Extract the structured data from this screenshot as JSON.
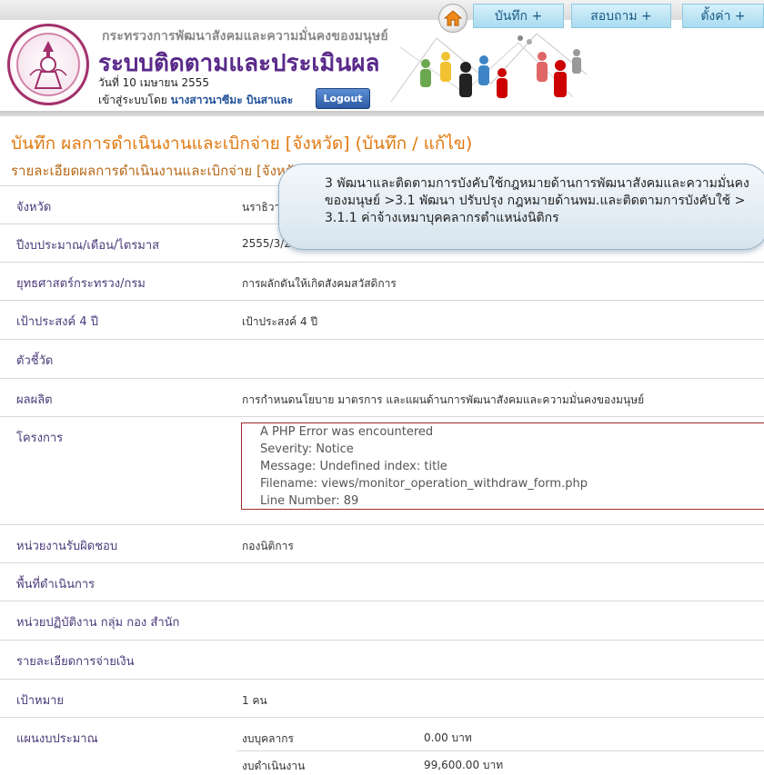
{
  "header": {
    "ministry": "กระทรวงการพัฒนาสังคมและความมั่นคงของมนุษย์",
    "system_title": "ระบบติดตามและประเมินผล",
    "date": "วันที่ 10 เมษายน 2555",
    "login_prefix": "เข้าสู่ระบบโดย",
    "username": "นางสาวนาซีมะ บินสาและ",
    "logout_label": "Logout",
    "nav": [
      "บันทึก +",
      "สอบถาม +",
      "ตั้งค่า +"
    ],
    "accent_color": "#5a2a8a"
  },
  "page": {
    "title": "บันทึก ผลการดำเนินงานและเบิกจ่าย [จังหวัด] (บันทึก / แก้ไข)",
    "section": "รายละเอียดผลการดำเนินงานและเบิกจ่าย [จังหวัด]"
  },
  "fields": [
    {
      "label": "จังหวัด",
      "value": "นราธิวาส"
    },
    {
      "label": "ปีงบประมาณ/เดือน/ไตรมาส",
      "value": "2555/3/2"
    },
    {
      "label": "ยุทธศาสตร์กระทรวง/กรม",
      "value": "การผลักดันให้เกิดสังคมสวัสดิการ"
    },
    {
      "label": "เป้าประสงค์ 4 ปี",
      "value": "เป้าประสงค์ 4 ปี"
    },
    {
      "label": "ตัวชี้วัด",
      "value": ""
    },
    {
      "label": "ผลผลิต",
      "value": "การกำหนดนโยบาย มาตรการ และแผนด้านการพัฒนาสังคมและความมั่นคงของมนุษย์"
    },
    {
      "label": "โครงการ",
      "value": ""
    },
    {
      "label": "หน่วยงานรับผิดชอบ",
      "value": "กองนิติการ"
    },
    {
      "label": "พื้นที่ดำเนินการ",
      "value": ""
    },
    {
      "label": "หน่วยปฏิบัติงาน กลุ่ม กอง สำนัก",
      "value": ""
    },
    {
      "label": "รายละเอียดการจ่ายเงิน",
      "value": ""
    },
    {
      "label": "เป้าหมาย",
      "value": "1 คน"
    },
    {
      "label": "แผนงบประมาณ",
      "value": ""
    }
  ],
  "php_error": {
    "title": "A PHP Error was encountered",
    "severity": "Severity: Notice",
    "message": "Message: Undefined index: title",
    "filename": "Filename: views/monitor_operation_withdraw_form.php",
    "line": "Line Number: 89"
  },
  "budget": [
    {
      "label": "งบบุคลากร",
      "value": "0.00 บาท"
    },
    {
      "label": "งบดำเนินงาน",
      "value": "99,600.00 บาท"
    }
  ],
  "tooltip": {
    "text": "3 พัฒนาและติดตามการบังคับใช้กฎหมายด้านการพัฒนาสังคมและความมั่นคงของมนุษย์ >3.1 พัฒนา ปรับปรุง กฎหมายด้านพม.และติดตามการบังคับใช้ > 3.1.1 ค่าจ้างเหมาบุคคลากรตำแหน่งนิติกร"
  }
}
